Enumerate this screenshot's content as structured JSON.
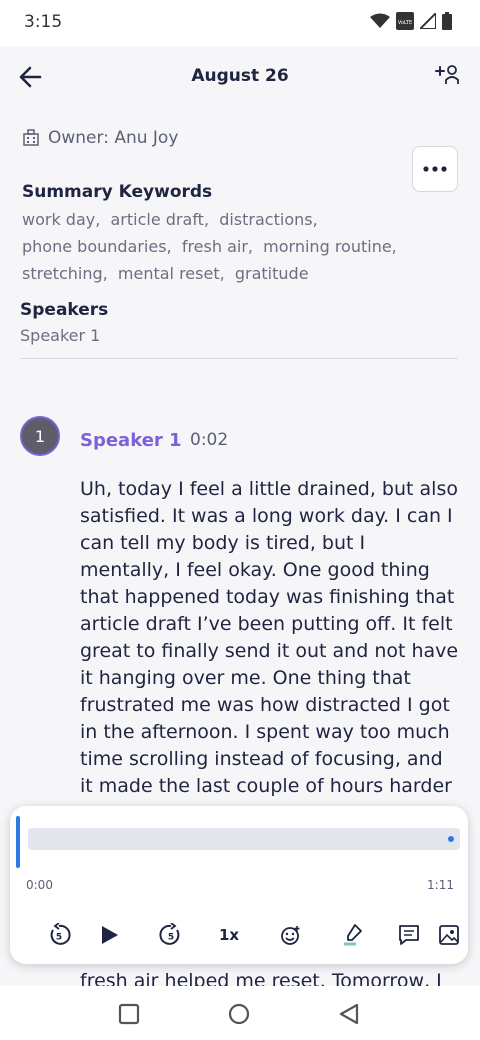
{
  "status_bar": {
    "time": "3:15",
    "icons": [
      "wifi-icon",
      "volte-icon",
      "signal-icon",
      "battery-icon"
    ],
    "volte_text": "VoLTE"
  },
  "header": {
    "title": "August 26"
  },
  "owner": {
    "label": "Owner: Anu Joy"
  },
  "summary": {
    "title": "Summary Keywords",
    "keywords": [
      "work day,",
      "article draft,",
      "distractions,",
      "phone boundaries,",
      "fresh air,",
      "morning routine,",
      "stretching,",
      "mental reset,",
      "gratitude"
    ]
  },
  "speakers": {
    "title": "Speakers",
    "value": "Speaker 1"
  },
  "segment": {
    "avatar_number": "1",
    "speaker": "Speaker 1",
    "timestamp": "0:02",
    "text": "Uh, today I feel a little drained, but also satisfied. It was a long work day. I can I can tell my body is tired, but I mentally, I feel okay. One good thing that happened today was finishing that article draft I’ve been putting off. It felt great to finally send it out and not have it hanging over me. One thing that frustrated me was how distracted I got in the afternoon. I spent way too much time scrolling instead of focusing, and it made the last couple of hours harder",
    "tail_text": "fresh air helped me reset. Tomorrow, I"
  },
  "player": {
    "time_start": "0:00",
    "time_end": "1:11",
    "speed": "1x",
    "progress": 0.0
  },
  "colors": {
    "accent": "#7b62d6",
    "progress": "#2c7be5",
    "text": "#1f2540",
    "muted": "#6a6f82"
  }
}
